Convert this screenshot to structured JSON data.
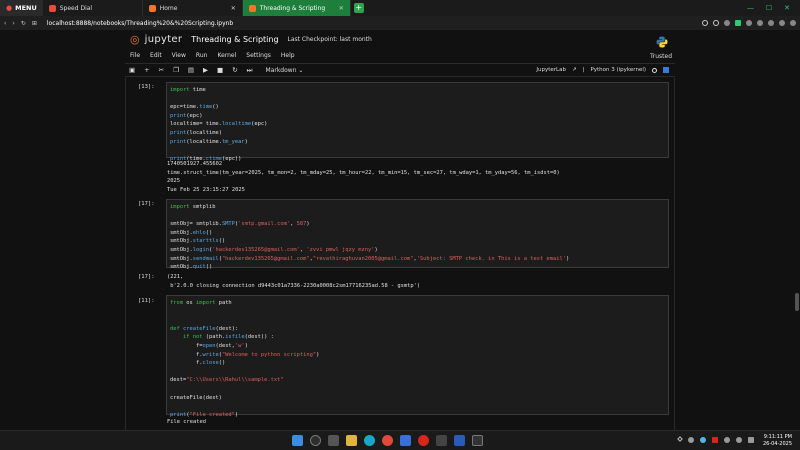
{
  "browser": {
    "menu_label": "MENU",
    "tabs": [
      {
        "label": "Speed Dial",
        "color": "#e94b3c"
      },
      {
        "label": "Home",
        "color": "#f37726"
      },
      {
        "label": "Threading & Scripting",
        "color": "#f37726"
      }
    ],
    "new_tab": "+",
    "url": "localhost:8888/notebooks/Threading%20&%20Scripting.ipynb",
    "accent": "#1e7f3d"
  },
  "jupyter": {
    "logo_text": "jupyter",
    "notebook_title": "Threading & Scripting",
    "checkpoint": "Last Checkpoint: last month",
    "menu": [
      "File",
      "Edit",
      "View",
      "Run",
      "Kernel",
      "Settings",
      "Help"
    ],
    "trusted": "Trusted",
    "cell_type": "Markdown",
    "jupyterlab_label": "JupyterLab",
    "kernel_label": "Python 3 (ipykernel)"
  },
  "cells": {
    "c1": {
      "prompt": "[13]:",
      "output": "1740501927.455602\ntime.struct_time(tm_year=2025, tm_mon=2, tm_mday=25, tm_hour=22, tm_min=15, tm_sec=27, tm_wday=1, tm_yday=56, tm_isdst=0)\n2025\nTue Feb 25 23:15:27 2025"
    },
    "c2": {
      "prompt": "[17]:"
    },
    "c3": {
      "prompt": "[17]:",
      "output": "(221,\n b'2.0.0 closing connection d9443c01a7336-2230a0008c2sm17716235ad.58 - gsmtp')"
    },
    "c4": {
      "prompt": "[11]:",
      "output": "File created"
    }
  },
  "taskbar": {
    "time": "9:11:11 PM",
    "date": "26-04-2025"
  }
}
